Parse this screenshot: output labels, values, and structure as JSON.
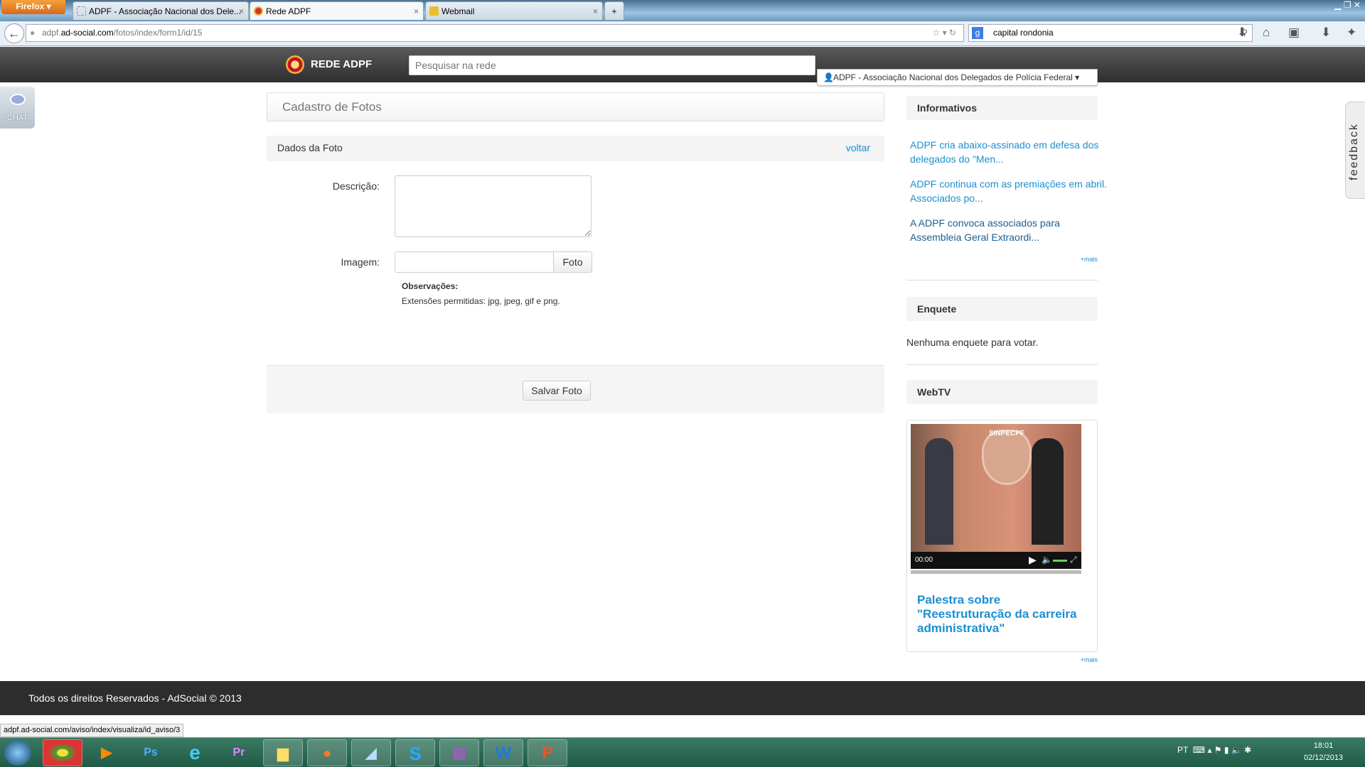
{
  "browser": {
    "menu_label": "Firefox",
    "tabs": [
      {
        "label": "ADPF - Associação Nacional dos Dele...",
        "active": false
      },
      {
        "label": "Rede ADPF",
        "active": true
      },
      {
        "label": "Webmail",
        "active": false
      }
    ],
    "url_prefix": "adpf.",
    "url_domain": "ad-social.com",
    "url_path": "/fotos/index/form1/id/15",
    "search_value": "capital rondonia",
    "status_url": "adpf.ad-social.com/aviso/index/visualiza/id_aviso/3"
  },
  "header": {
    "brand": "REDE ADPF",
    "search_placeholder": "Pesquisar na rede",
    "user_menu": "ADPF - Associação Nacional dos Delegados de Polícia Federal"
  },
  "chat": {
    "label": "CHAT"
  },
  "feedback": {
    "label": "feedback"
  },
  "main": {
    "title": "Cadastro de Fotos",
    "section_title": "Dados da Foto",
    "back_link": "voltar",
    "description_label": "Descrição:",
    "description_value": "",
    "image_label": "Imagem:",
    "image_value": "",
    "photo_button": "Foto",
    "notes_title": "Observações:",
    "notes_text": "Extensões permitidas: jpg, jpeg, gif e png.",
    "save_button": "Salvar Foto"
  },
  "sidebar": {
    "informativos_title": "Informativos",
    "news": [
      "ADPF cria abaixo-assinado em defesa dos delegados do \"Men...",
      "ADPF continua com as premiações em abril. Associados po...",
      "A ADPF convoca associados para Assembleia Geral Extraordi..."
    ],
    "more": "+mais",
    "enquete_title": "Enquete",
    "enquete_text": "Nenhuma enquete para votar.",
    "webtv_title": "WebTV",
    "video_seal_text": "SINPECPF",
    "video_time": "00:00",
    "video_title": "Palestra sobre \"Reestruturação da carreira administrativa\"",
    "webtv_more": "+mais"
  },
  "footer": {
    "text": "Todos os direitos Reservados - AdSocial © 2013"
  },
  "taskbar": {
    "apps": [
      "chrome",
      "media-player",
      "photoshop",
      "internet-explorer",
      "premiere",
      "file-explorer",
      "firefox",
      "notepad",
      "skype",
      "winrar",
      "word",
      "powerpoint"
    ],
    "language": "PT",
    "time": "18:01",
    "date": "02/12/2013"
  },
  "colors": {
    "link": "#1a8fd0",
    "header_bg": "#2e2e2e",
    "taskbar": "#2a6b53"
  }
}
